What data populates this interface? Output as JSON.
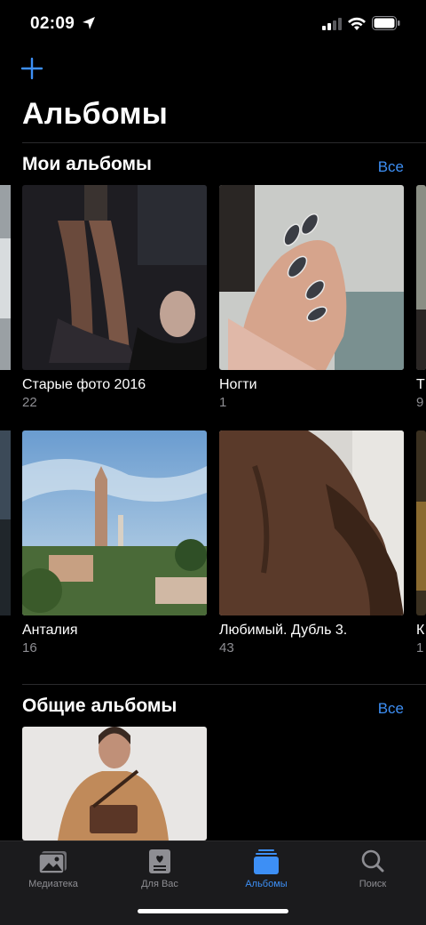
{
  "status": {
    "time": "02:09"
  },
  "header": {
    "title": "Альбомы"
  },
  "my_albums": {
    "title": "Мои альбомы",
    "see_all": "Все",
    "items": [
      {
        "name": "Старые фото 2016",
        "count": "22"
      },
      {
        "name": "Ногти",
        "count": "1"
      },
      {
        "name": "Анталия",
        "count": "16"
      },
      {
        "name": "Любимый. Дубль 3.",
        "count": "43"
      }
    ],
    "partial_right": [
      {
        "name": "Т",
        "count": "9"
      },
      {
        "name": "К",
        "count": "1"
      }
    ]
  },
  "shared_albums": {
    "title": "Общие альбомы",
    "see_all": "Все"
  },
  "tabs": [
    {
      "label": "Медиатека",
      "icon": "photo-library-icon",
      "active": false
    },
    {
      "label": "Для Вас",
      "icon": "for-you-icon",
      "active": false
    },
    {
      "label": "Альбомы",
      "icon": "albums-icon",
      "active": true
    },
    {
      "label": "Поиск",
      "icon": "search-icon",
      "active": false
    }
  ],
  "colors": {
    "accent": "#3d8ff5",
    "secondary_text": "#8e8e93",
    "background": "#000000"
  }
}
